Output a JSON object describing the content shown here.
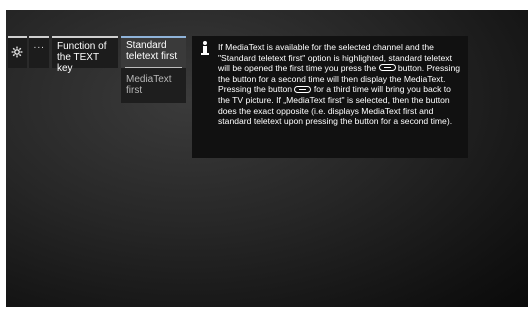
{
  "menu": {
    "dots_label": "···",
    "function_label": "Function of the TEXT key",
    "options": [
      {
        "label": "Standard teletext first",
        "selected": true
      },
      {
        "label": "MediaText first",
        "selected": false
      }
    ]
  },
  "info": {
    "icon": "info-icon",
    "text": {
      "p1": "If MediaText is available for the selected channel and the \"Standard teletext first\" option is highlighted, standard teletext will be opened the first time you press the",
      "p2": "button. Pressing the button for a second time will then display the MediaText. Pressing the button",
      "p3": "for a third time will bring you back to the TV picture. If „MediaText first\" is selected, then the button does the exact opposite (i.e. displays MediaText first and standard teletext upon pressing the button for a second time)."
    }
  },
  "colors": {
    "selected_highlight": "#3a3a3a",
    "selected_top_bar": "#8fb3d9",
    "panel_background": "#111111"
  }
}
